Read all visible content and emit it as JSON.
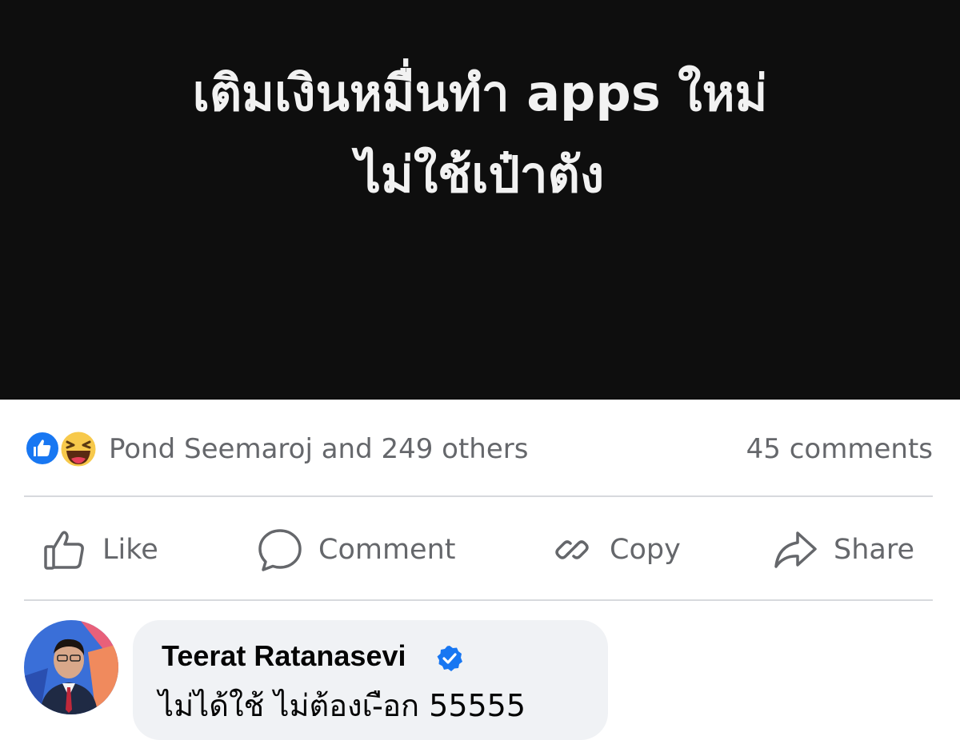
{
  "post": {
    "image_text_line1": "เติมเงินหมื่นทำ apps ใหม่",
    "image_text_line2": "ไม่ใช้เป๋าตัง",
    "background_color": "#0e0e0e"
  },
  "reactions": {
    "icons": [
      "like-reaction-icon",
      "haha-reaction-icon"
    ],
    "summary": "Pond Seemaroj and 249 others",
    "comments_count": "45 comments"
  },
  "actions": {
    "like": {
      "label": "Like",
      "icon": "thumbs-up-icon"
    },
    "comment": {
      "label": "Comment",
      "icon": "speech-bubble-icon"
    },
    "copy": {
      "label": "Copy",
      "icon": "link-icon"
    },
    "share": {
      "label": "Share",
      "icon": "share-arrow-icon"
    }
  },
  "comment": {
    "author": "Teerat Ratanasevi",
    "verified": true,
    "text": "ไม่ได้ใช้ ไม่ต้องเ-ือก 55555"
  },
  "colors": {
    "accent": "#1877f2",
    "muted_text": "#65676b",
    "bubble": "#f0f2f5",
    "divider": "#d7d9dd"
  }
}
